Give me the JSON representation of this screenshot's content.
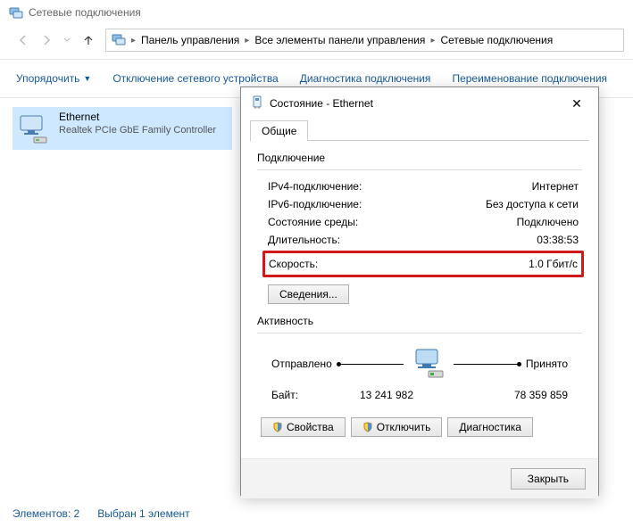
{
  "window": {
    "title": "Сетевые подключения"
  },
  "breadcrumb": {
    "items": [
      "Панель управления",
      "Все элементы панели управления",
      "Сетевые подключения"
    ]
  },
  "commands": {
    "organize": "Упорядочить",
    "disable": "Отключение сетевого устройства",
    "diagnose": "Диагностика подключения",
    "rename": "Переименование подключения"
  },
  "connection": {
    "name": "Ethernet",
    "status": "",
    "adapter": "Realtek PCIe GbE Family Controller"
  },
  "dialog": {
    "title": "Состояние - Ethernet",
    "tab": "Общие",
    "group_connection": "Подключение",
    "rows": {
      "ipv4_label": "IPv4-подключение:",
      "ipv4_value": "Интернет",
      "ipv6_label": "IPv6-подключение:",
      "ipv6_value": "Без доступа к сети",
      "media_label": "Состояние среды:",
      "media_value": "Подключено",
      "duration_label": "Длительность:",
      "duration_value": "03:38:53",
      "speed_label": "Скорость:",
      "speed_value": "1.0 Гбит/с"
    },
    "details_btn": "Сведения...",
    "group_activity": "Активность",
    "activity": {
      "sent": "Отправлено",
      "received": "Принято",
      "bytes_label": "Байт:",
      "bytes_sent": "13 241 982",
      "bytes_recv": "78 359 859"
    },
    "buttons": {
      "properties": "Свойства",
      "disable": "Отключить",
      "diagnose": "Диагностика"
    },
    "close": "Закрыть"
  },
  "statusbar": {
    "count": "Элементов: 2",
    "selection": "Выбран 1 элемент"
  }
}
